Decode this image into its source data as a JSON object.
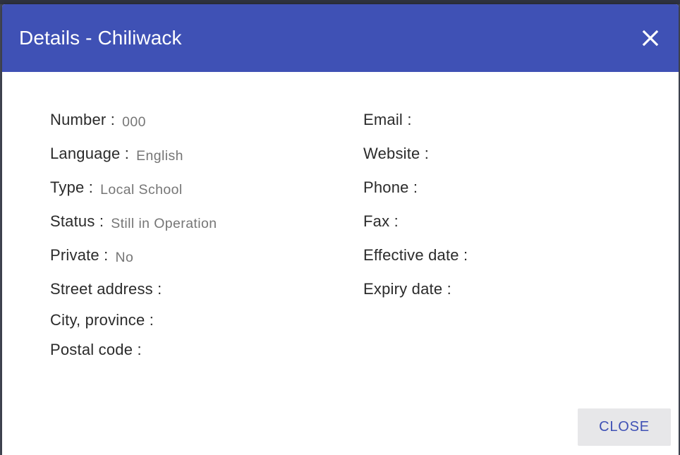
{
  "dialog": {
    "title": "Details - Chiliwack",
    "close_button_label": "CLOSE",
    "header_color": "#3f51b5",
    "close_icon": "close-icon"
  },
  "left_fields": [
    {
      "label": "Number :",
      "value": "000"
    },
    {
      "label": "Language :",
      "value": "English"
    },
    {
      "label": "Type :",
      "value": "Local School"
    },
    {
      "label": "Status :",
      "value": "Still in Operation"
    },
    {
      "label": "Private :",
      "value": "No"
    },
    {
      "label": "Street address :",
      "value": ""
    },
    {
      "label": "City, province :",
      "value": ""
    },
    {
      "label": "Postal code :",
      "value": ""
    }
  ],
  "right_fields": [
    {
      "label": "Email :",
      "value": ""
    },
    {
      "label": "Website :",
      "value": ""
    },
    {
      "label": "Phone :",
      "value": ""
    },
    {
      "label": "Fax :",
      "value": ""
    },
    {
      "label": "Effective date :",
      "value": ""
    },
    {
      "label": "Expiry date :",
      "value": ""
    }
  ]
}
